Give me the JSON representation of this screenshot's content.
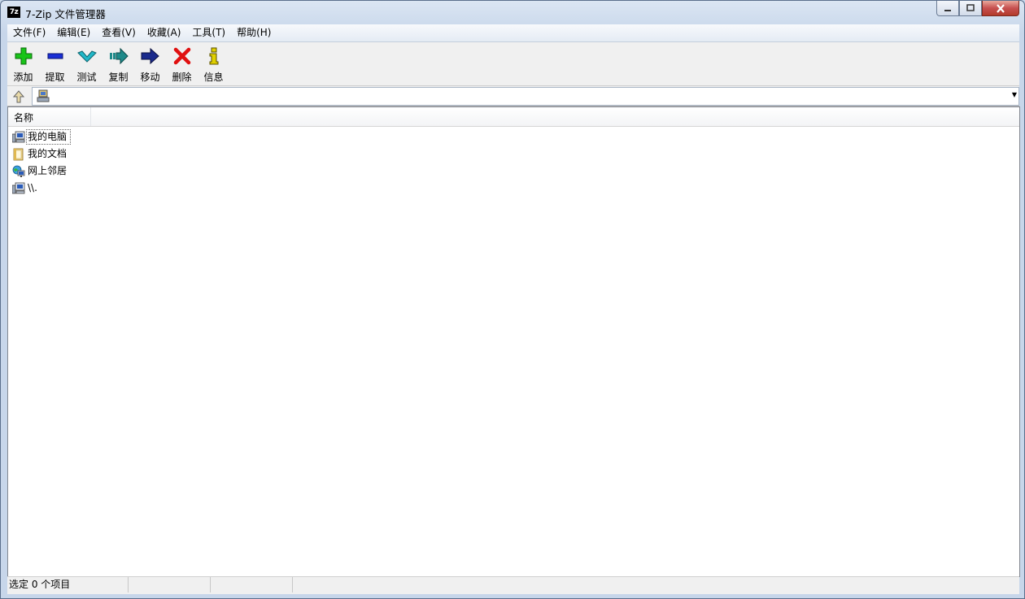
{
  "window": {
    "title": "7-Zip 文件管理器",
    "app_icon_text": "7z",
    "controls": {
      "minimize": "—",
      "maximize": "□",
      "close": "✕"
    }
  },
  "menu": [
    {
      "label": "文件(F)"
    },
    {
      "label": "编辑(E)"
    },
    {
      "label": "查看(V)"
    },
    {
      "label": "收藏(A)"
    },
    {
      "label": "工具(T)"
    },
    {
      "label": "帮助(H)"
    }
  ],
  "toolbar": [
    {
      "label": "添加",
      "icon": "plus-icon",
      "color": "#19c419"
    },
    {
      "label": "提取",
      "icon": "minus-icon",
      "color": "#1a2ed6"
    },
    {
      "label": "测试",
      "icon": "check-icon",
      "color": "#22b8c8"
    },
    {
      "label": "复制",
      "icon": "copy-arrow-icon",
      "color": "#1f8a8a"
    },
    {
      "label": "移动",
      "icon": "move-arrow-icon",
      "color": "#1a2a8c"
    },
    {
      "label": "删除",
      "icon": "delete-x-icon",
      "color": "#e01010"
    },
    {
      "label": "信息",
      "icon": "info-icon",
      "color": "#e0d000"
    }
  ],
  "address": {
    "value": "",
    "icon": "computers-icon"
  },
  "list": {
    "columns": [
      {
        "label": "名称"
      }
    ],
    "items": [
      {
        "label": "我的电脑",
        "icon": "computer-icon"
      },
      {
        "label": "我的文档",
        "icon": "documents-folder-icon"
      },
      {
        "label": "网上邻居",
        "icon": "network-icon"
      },
      {
        "label": "\\\\.",
        "icon": "computer-icon"
      }
    ]
  },
  "status": {
    "selection": "选定 0 个项目",
    "cell2": "",
    "cell3": ""
  }
}
